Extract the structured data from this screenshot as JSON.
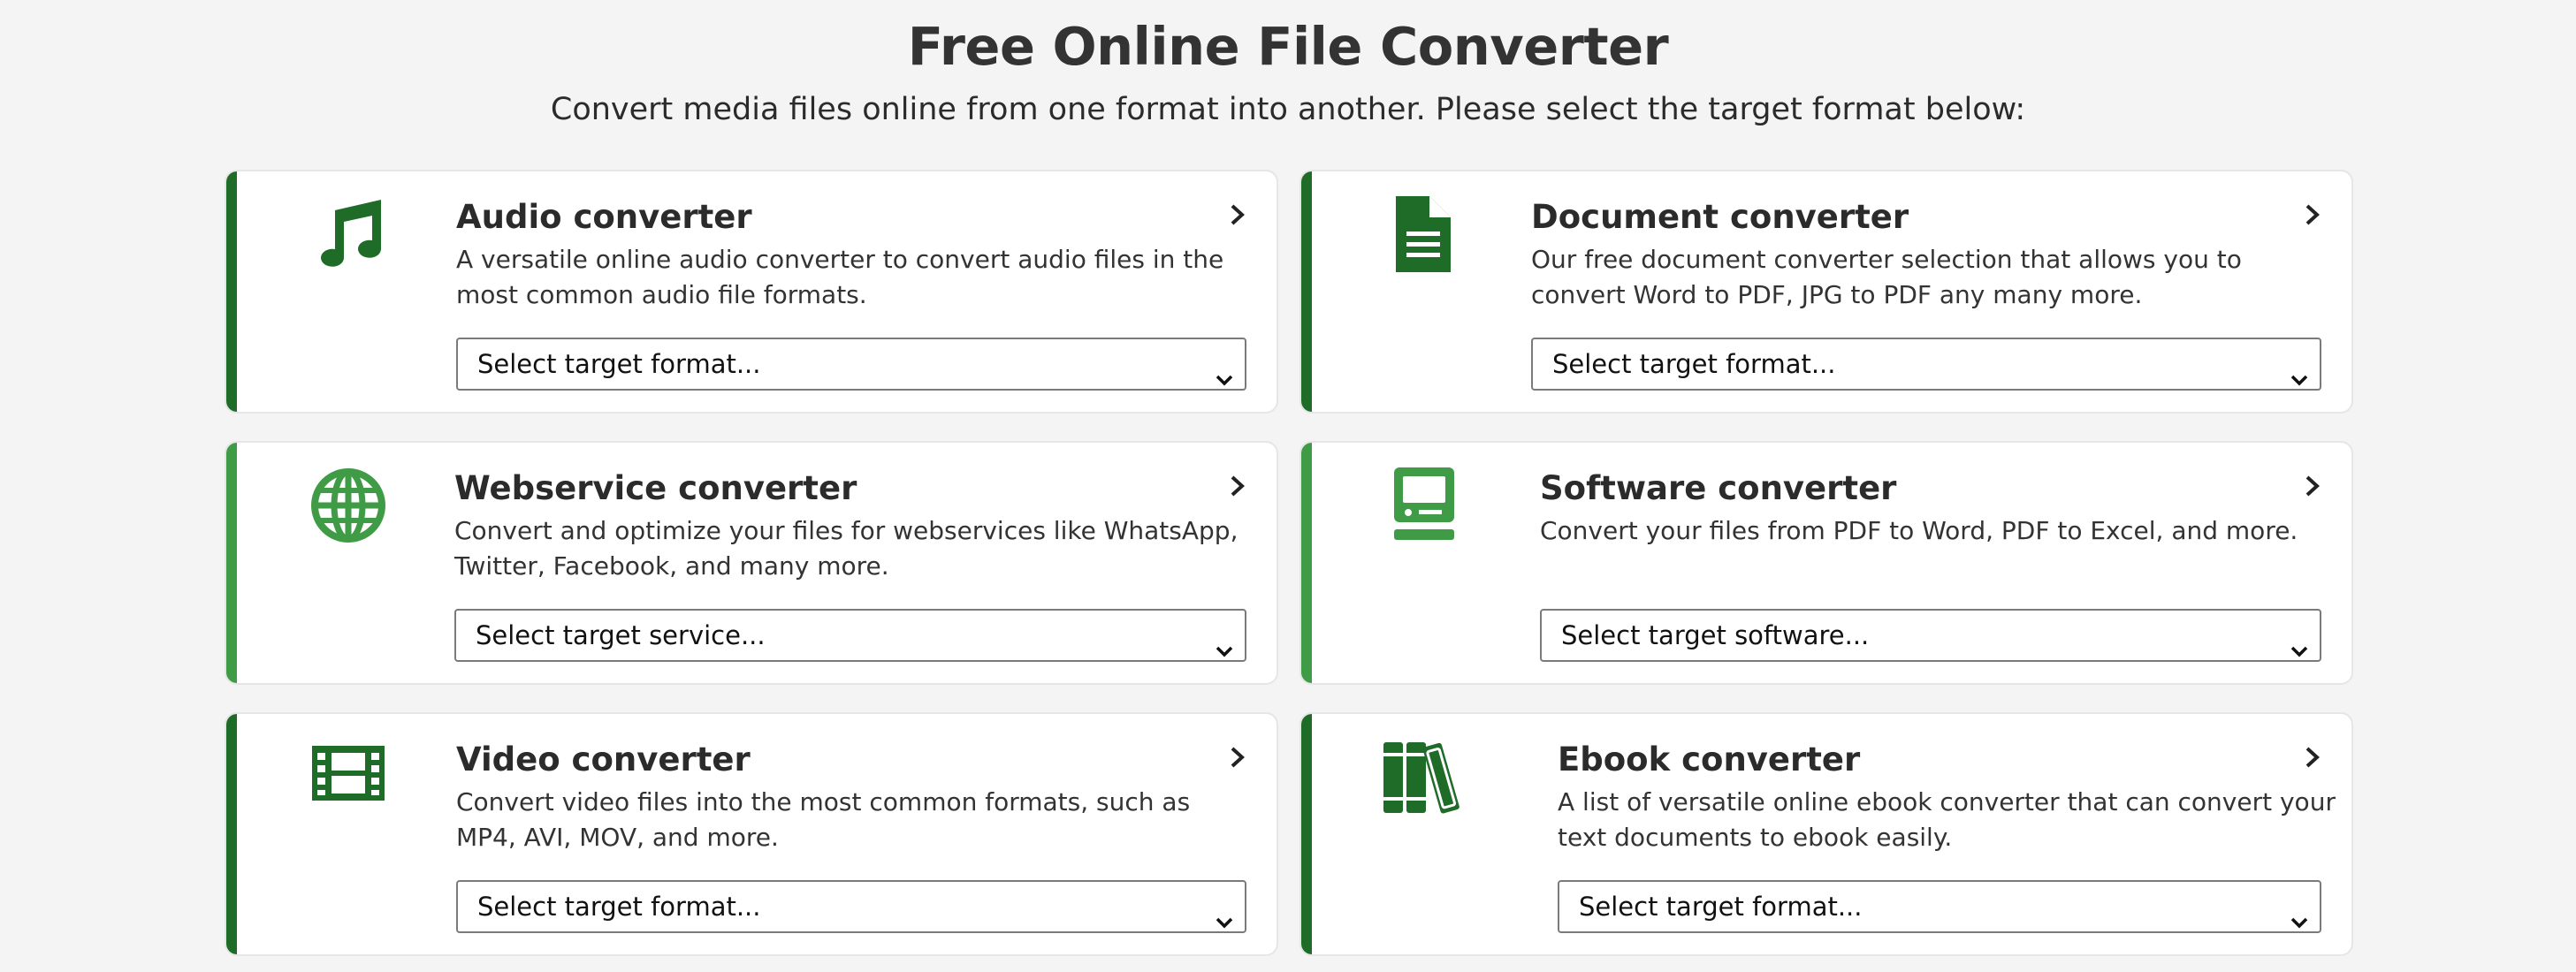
{
  "header": {
    "title": "Free Online File Converter",
    "subtitle": "Convert media files online from one format into another. Please select the target format below:"
  },
  "colors": {
    "accent_dark": "#1f6b28",
    "accent_light": "#3f9b45",
    "card_bg": "#ffffff",
    "page_bg": "#f4f4f4"
  },
  "cards": [
    {
      "title": "Audio converter",
      "description": "A versatile online audio converter to convert audio files in the most common audio file formats.",
      "select_value": "Select target format...",
      "icon": "music-note-icon"
    },
    {
      "title": "Document converter",
      "description": "Our free document converter selection that allows you to convert Word to PDF, JPG to PDF any many more.",
      "select_value": "Select target format...",
      "icon": "document-icon"
    },
    {
      "title": "Webservice converter",
      "description": "Convert and optimize your files for webservices like WhatsApp, Twitter, Facebook, and many more.",
      "select_value": "Select target service...",
      "icon": "globe-icon"
    },
    {
      "title": "Software converter",
      "description": "Convert your files from PDF to Word, PDF to Excel, and more.",
      "select_value": "Select target software...",
      "icon": "computer-icon"
    },
    {
      "title": "Video converter",
      "description": "Convert video files into the most common formats, such as MP4, AVI, MOV, and more.",
      "select_value": "Select target format...",
      "icon": "film-icon"
    },
    {
      "title": "Ebook converter",
      "description": "A list of versatile online ebook converter that can convert your text documents to ebook easily.",
      "select_value": "Select target format...",
      "icon": "books-icon"
    }
  ]
}
